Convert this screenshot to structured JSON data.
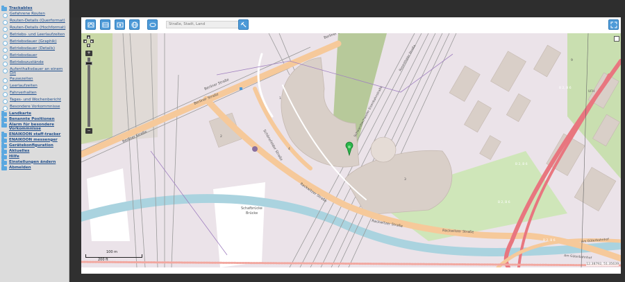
{
  "sidebar": {
    "items": [
      {
        "label": "Trackables",
        "kind": "folder",
        "bold": true
      },
      {
        "label": "Gefahrene Routen",
        "kind": "sub"
      },
      {
        "label": "Routen-Details (Querformat)",
        "kind": "sub"
      },
      {
        "label": "Routen-Details (Hochformat)",
        "kind": "sub"
      },
      {
        "label": "Betriebs- und Leerlaufzeiten",
        "kind": "sub"
      },
      {
        "label": "Betriebsdauer (Graphik)",
        "kind": "sub"
      },
      {
        "label": "Betriebsdauer (Details)",
        "kind": "sub"
      },
      {
        "label": "Betriebsdauer",
        "kind": "sub"
      },
      {
        "label": "Betriebszustände",
        "kind": "sub"
      },
      {
        "label": "Aufenthaltsdauer an einem Ort",
        "kind": "sub"
      },
      {
        "label": "Pausezeiten",
        "kind": "sub"
      },
      {
        "label": "Leerlaufzeiten",
        "kind": "sub"
      },
      {
        "label": "Fahrverhalten",
        "kind": "sub"
      },
      {
        "label": "Tages- und Wochenbericht",
        "kind": "sub"
      },
      {
        "label": "Besondere Vorkommnisse",
        "kind": "sub"
      },
      {
        "label": "Landkarte",
        "kind": "folder",
        "bold": true
      },
      {
        "label": "Benannte Positionen",
        "kind": "folder",
        "bold": true
      },
      {
        "label": "Alarm für besondere Vorkommnisse",
        "kind": "folder",
        "bold": true
      },
      {
        "label": "ENAIKOON staff-tracker",
        "kind": "folder",
        "bold": true
      },
      {
        "label": "ENAIKOON messenger",
        "kind": "folder",
        "bold": true
      },
      {
        "label": "Gerätekonfiguration",
        "kind": "folder",
        "bold": true
      },
      {
        "label": "Aktuelles",
        "kind": "folder",
        "bold": true
      },
      {
        "label": "Hilfe",
        "kind": "folder",
        "bold": true
      },
      {
        "label": "Einstellungen ändern",
        "kind": "folder",
        "bold": true
      },
      {
        "label": "Abmelden",
        "kind": "folder",
        "bold": true
      }
    ]
  },
  "toolbar": {
    "search_placeholder": "Straße, Stadt, Land",
    "icons": [
      "map-tool-1-icon",
      "map-tool-2-icon",
      "map-tool-3-icon",
      "globe-icon",
      "map-tool-5-icon",
      "pin-tool-icon",
      "fullscreen-icon"
    ]
  },
  "map": {
    "labels": {
      "berliner1": "Berliner Straße",
      "berliner2": "Berliner Straße",
      "berliner3": "Berliner Straße",
      "berliner4": "Berliner Straße",
      "rackwitzer1": "Rackwitzer Straße",
      "rackwitzer2": "Rackwitzer Straße",
      "rackwitzer3": "Rackwitzer Straße",
      "schoenefelder": "Schönefelder Straße",
      "rosenthaler": "Rosenthaler Straße",
      "kunstler": "Schwarzbachweiler Eisenbahnstraße",
      "schafbruecke1": "Schafbrücke",
      "schafbruecke2": "Brücke",
      "amgueter1": "Am Güterbahnhof",
      "amgueter2": "Am Güterbahnhof",
      "b2a": "B 2, B 6",
      "b2b": "B 2, B 6",
      "b2c": "B 2, B 6",
      "b2d": "B 2, B 6",
      "ufh": "UFH",
      "n9": "9",
      "n1": "1",
      "n2": "2",
      "n3": "3",
      "n4": "4"
    },
    "scale": {
      "top": "100 m",
      "bottom": "200 ft"
    },
    "coords": "12.38792, 51.35639",
    "marker_color": "#2bb54a"
  }
}
